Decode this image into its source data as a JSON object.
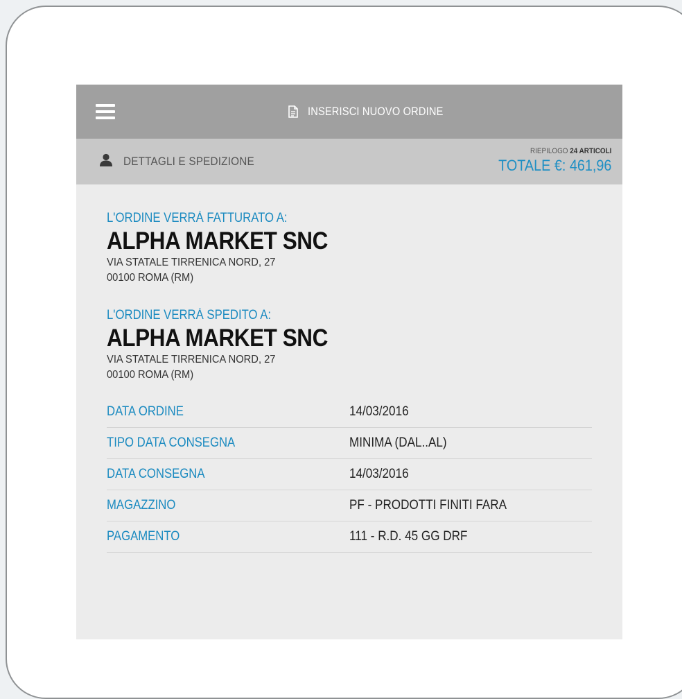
{
  "header": {
    "menu_icon": "hamburger-menu-icon",
    "doc_icon": "document-icon",
    "title": "INSERISCI NUOVO ORDINE"
  },
  "subheader": {
    "user_icon": "user-icon",
    "label": "DETTAGLI E SPEDIZIONE",
    "summary_prefix": "RIEPILOGO",
    "summary_count": "24 ARTICOLI",
    "total": "TOTALE €: 461,96"
  },
  "billing": {
    "label": "L'ORDINE VERRÀ FATTURATO A:",
    "company": "ALPHA MARKET SNC",
    "address1": "VIA STATALE TIRRENICA NORD, 27",
    "address2": "00100 ROMA (RM)"
  },
  "shipping": {
    "label": "L'ORDINE VERRÀ SPEDITO A:",
    "company": "ALPHA MARKET SNC",
    "address1": "VIA STATALE TIRRENICA NORD, 27",
    "address2": "00100 ROMA (RM)"
  },
  "details": [
    {
      "label": "DATA ORDINE",
      "value": "14/03/2016"
    },
    {
      "label": "TIPO DATA CONSEGNA",
      "value": "MINIMA (DAL..AL)"
    },
    {
      "label": "DATA CONSEGNA",
      "value": "14/03/2016"
    },
    {
      "label": "MAGAZZINO",
      "value": "PF - PRODOTTI FINITI FARA"
    },
    {
      "label": "PAGAMENTO",
      "value": "111 - R.D. 45 GG DRF"
    }
  ],
  "colors": {
    "accent": "#1a8ac0",
    "topbar": "#a0a0a0",
    "subbar": "#c8c8c8",
    "background": "#ececec"
  }
}
